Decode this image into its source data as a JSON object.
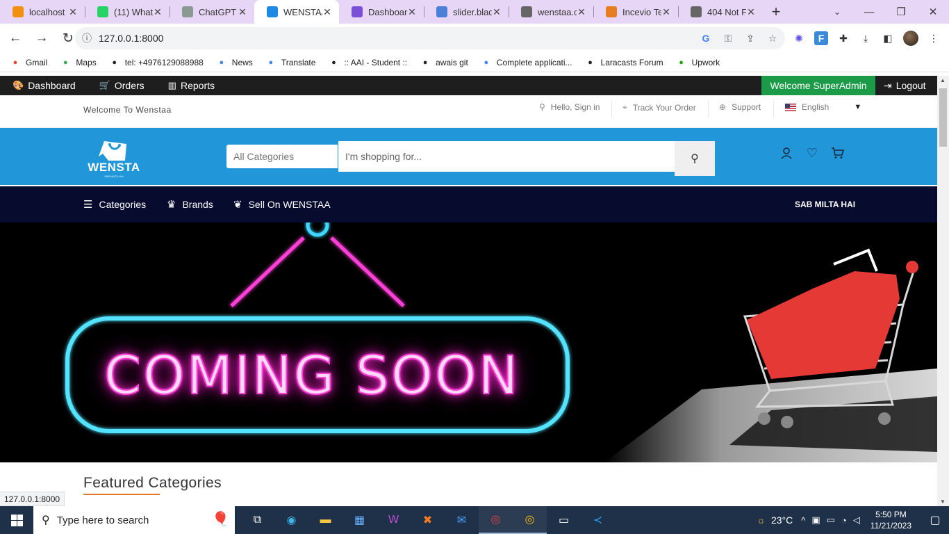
{
  "browser": {
    "tabs": [
      {
        "title": "localhost",
        "icon": "phpmyadmin-icon",
        "color": "#f29111"
      },
      {
        "title": "(11) What",
        "icon": "whatsapp-icon",
        "color": "#25d366"
      },
      {
        "title": "ChatGPT",
        "icon": "chatgpt-icon",
        "color": "#8a9a91"
      },
      {
        "title": "WENSTAA",
        "icon": "wenstaa-icon",
        "color": "#1e88e5",
        "active": true
      },
      {
        "title": "Dashboar",
        "icon": "dashboard-icon",
        "color": "#7b4fd6"
      },
      {
        "title": "slider.blad",
        "icon": "blade-file-icon",
        "color": "#4b7fd8"
      },
      {
        "title": "wenstaa.c",
        "icon": "globe-icon",
        "color": "#666"
      },
      {
        "title": "Incevio Te",
        "icon": "incevio-icon",
        "color": "#e67e22"
      },
      {
        "title": "404 Not F",
        "icon": "globe-icon",
        "color": "#666"
      }
    ],
    "url": "127.0.0.1:8000",
    "bookmarks": [
      {
        "label": "Gmail",
        "icon": "gmail-icon",
        "color": "#ea4335"
      },
      {
        "label": "Maps",
        "icon": "maps-icon",
        "color": "#34a853"
      },
      {
        "label": "tel: +4976129088988",
        "icon": "globe-icon",
        "color": "#222"
      },
      {
        "label": "News",
        "icon": "news-icon",
        "color": "#4285f4"
      },
      {
        "label": "Translate",
        "icon": "translate-icon",
        "color": "#4285f4"
      },
      {
        "label": ":: AAI - Student ::",
        "icon": "globe-icon",
        "color": "#222"
      },
      {
        "label": "awais git",
        "icon": "github-icon",
        "color": "#222"
      },
      {
        "label": "Complete applicati...",
        "icon": "google-icon",
        "color": "#4285f4"
      },
      {
        "label": "Laracasts Forum",
        "icon": "laracasts-icon",
        "color": "#222"
      },
      {
        "label": "Upwork",
        "icon": "upwork-icon",
        "color": "#14a800"
      }
    ],
    "status_url": "127.0.0.1:8000"
  },
  "admin": {
    "items": [
      {
        "label": "Dashboard",
        "icon": "palette-icon"
      },
      {
        "label": "Orders",
        "icon": "cart-icon"
      },
      {
        "label": "Reports",
        "icon": "bar-chart-icon"
      }
    ],
    "welcome": "Welcome SuperAdmin",
    "logout": "Logout"
  },
  "topbar": {
    "welcome": "Welcome To Wenstaa",
    "sign_in": "Hello, Sign in",
    "track": "Track Your Order",
    "support": "Support",
    "language": "English"
  },
  "header": {
    "logo_text": "WENSTA",
    "logo_sub": "SAB MILTA HAI",
    "category_select": "All Categories",
    "search_placeholder": "I'm shopping for...",
    "accent": "#2196d9"
  },
  "catnav": {
    "categories": "Categories",
    "brands": "Brands",
    "sell": "Sell On WENSTAA",
    "tagline": "SAB MILTA HAI"
  },
  "hero": {
    "title": "COMING SOON"
  },
  "featured": {
    "title": "Featured Categories"
  },
  "taskbar": {
    "search_placeholder": "Type here to search",
    "temperature": "23°C",
    "time": "5:50 PM",
    "date": "11/21/2023"
  }
}
